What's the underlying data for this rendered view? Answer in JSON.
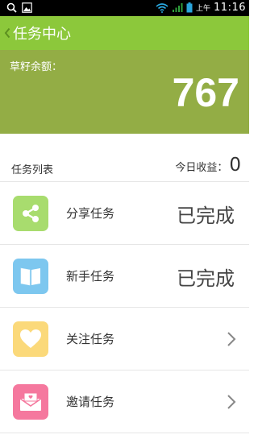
{
  "status_bar": {
    "ampm": "上午",
    "time": "11:16",
    "icons": [
      "search-icon",
      "image-icon",
      "wifi-icon",
      "signal-icon",
      "battery-icon"
    ]
  },
  "header": {
    "title": "任务中心",
    "back_icon": "chevron-left-icon",
    "color": "#8cc83b"
  },
  "balance": {
    "label": "草籽余额：",
    "value": "767",
    "color": "#93ad45"
  },
  "task_list": {
    "title": "任务列表",
    "today_label": "今日收益：",
    "today_value": "0",
    "tasks": [
      {
        "name": "分享任务",
        "status": "已完成",
        "icon": "share-icon",
        "icon_color": "#a8dc6e"
      },
      {
        "name": "新手任务",
        "status": "已完成",
        "icon": "book-icon",
        "icon_color": "#7dc7ef"
      },
      {
        "name": "关注任务",
        "status": "",
        "icon": "heart-icon",
        "icon_color": "#fbd97a"
      },
      {
        "name": "邀请任务",
        "status": "",
        "icon": "envelope-icon",
        "icon_color": "#f5789e"
      }
    ]
  }
}
